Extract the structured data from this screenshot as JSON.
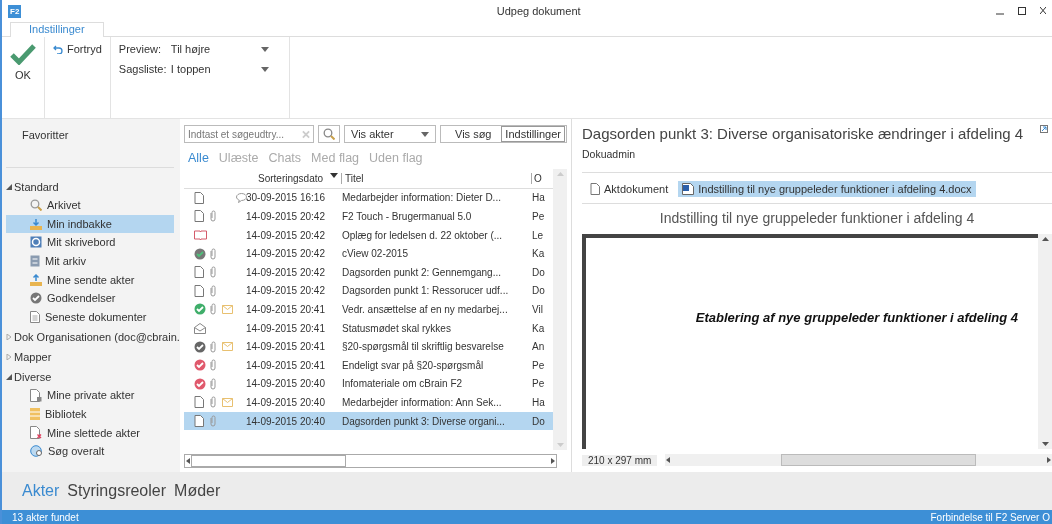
{
  "window": {
    "app_badge": "F2",
    "title": "Udpeg dokument"
  },
  "ribbon": {
    "tabs": [
      {
        "label": "Indstillinger",
        "selected": true
      }
    ],
    "ok": "OK",
    "undo": "Fortryd",
    "settings": [
      {
        "label": "Preview:",
        "value": "Til højre"
      },
      {
        "label": "Sagsliste:",
        "value": "I toppen"
      }
    ]
  },
  "sidebar": {
    "favorites": "Favoritter",
    "groups": [
      {
        "label": "Standard",
        "expanded": true,
        "children": [
          {
            "label": "Arkivet",
            "kind": "search",
            "selected": false
          },
          {
            "label": "Min indbakke",
            "kind": "inbox",
            "selected": true
          },
          {
            "label": "Mit skrivebord",
            "kind": "desk",
            "selected": false
          },
          {
            "label": "Mit arkiv",
            "kind": "cabinet",
            "selected": false
          },
          {
            "label": "Mine sendte akter",
            "kind": "outbox",
            "selected": false
          },
          {
            "label": "Godkendelser",
            "kind": "approval",
            "selected": false
          },
          {
            "label": "Seneste dokumenter",
            "kind": "document",
            "selected": false
          }
        ]
      },
      {
        "label": "Dok Organisationen (doc@cbrain.",
        "expanded": false
      },
      {
        "label": "Mapper",
        "expanded": false
      },
      {
        "label": "Diverse",
        "expanded": true,
        "children": [
          {
            "label": "Mine private akter",
            "kind": "private",
            "selected": false
          },
          {
            "label": "Bibliotek",
            "kind": "library",
            "selected": false
          },
          {
            "label": "Mine slettede akter",
            "kind": "deleted",
            "selected": false
          },
          {
            "label": "Søg overalt",
            "kind": "globe",
            "selected": false
          }
        ]
      }
    ]
  },
  "list": {
    "search": {
      "placeholder": "Indtast et søgeudtry..."
    },
    "view_select": "Vis akter",
    "search_button": "Vis søg",
    "tooltip": "Indstillinger",
    "filters": [
      {
        "label": "Alle",
        "selected": true
      },
      {
        "label": "Ulæste",
        "selected": false
      },
      {
        "label": "Chats",
        "selected": false
      },
      {
        "label": "Med flag",
        "selected": false
      },
      {
        "label": "Uden flag",
        "selected": false
      }
    ],
    "columns": [
      "Sorteringsdato",
      "Titel",
      "O"
    ],
    "rows": [
      {
        "kind": "doc",
        "attachment": false,
        "comment": true,
        "folder": false,
        "date": "30-09-2015 16:16",
        "title": "Medarbejder information: Dieter D...",
        "column_3": "Ha",
        "selected": false
      },
      {
        "kind": "doc",
        "attachment": true,
        "comment": false,
        "folder": false,
        "date": "14-09-2015 20:42",
        "title": "F2 Touch - Brugermanual 5.0",
        "column_3": "Pe",
        "selected": false
      },
      {
        "kind": "book",
        "attachment": false,
        "comment": false,
        "folder": false,
        "date": "14-09-2015 20:42",
        "title": "Oplæg for ledelsen d. 22 oktober (...",
        "column_3": "Le",
        "selected": false
      },
      {
        "kind": "partial",
        "attachment": true,
        "comment": false,
        "folder": false,
        "date": "14-09-2015 20:42",
        "title": "cView 02-2015",
        "column_3": "Ka",
        "selected": false
      },
      {
        "kind": "doc",
        "attachment": true,
        "comment": false,
        "folder": false,
        "date": "14-09-2015 20:42",
        "title": "Dagsorden punkt 2: Gennemgang...",
        "column_3": "Do",
        "selected": false
      },
      {
        "kind": "doc",
        "attachment": true,
        "comment": false,
        "folder": false,
        "date": "14-09-2015 20:42",
        "title": "Dagsorden punkt 1: Ressorucer udf...",
        "column_3": "Do",
        "selected": false
      },
      {
        "kind": "check",
        "color": "#3fae6a",
        "attachment": true,
        "comment": false,
        "folder": true,
        "date": "14-09-2015 20:41",
        "title": "Vedr. ansættelse af en ny medarbej...",
        "column_3": "Vil",
        "selected": false
      },
      {
        "kind": "envelope",
        "attachment": false,
        "comment": false,
        "folder": false,
        "date": "14-09-2015 20:41",
        "title": "Statusmødet skal rykkes",
        "column_3": "Ka",
        "selected": false
      },
      {
        "kind": "check",
        "color": "#666666",
        "attachment": true,
        "comment": false,
        "folder": true,
        "date": "14-09-2015 20:41",
        "title": "§20-spørgsmål til skriftlig besvarelse",
        "column_3": "An",
        "selected": false
      },
      {
        "kind": "check",
        "color": "#e0596c",
        "attachment": true,
        "comment": false,
        "folder": false,
        "date": "14-09-2015 20:41",
        "title": "Endeligt svar på §20-spørgsmål",
        "column_3": "Pe",
        "selected": false
      },
      {
        "kind": "check",
        "color": "#e0596c",
        "attachment": true,
        "comment": false,
        "folder": false,
        "date": "14-09-2015 20:40",
        "title": "Infomateriale om cBrain F2",
        "column_3": "Pe",
        "selected": false
      },
      {
        "kind": "doc",
        "attachment": true,
        "comment": false,
        "folder": true,
        "date": "14-09-2015 20:40",
        "title": "Medarbejder information: Ann Sek...",
        "column_3": "Ha",
        "selected": false
      },
      {
        "kind": "doc",
        "attachment": true,
        "comment": false,
        "folder": false,
        "date": "14-09-2015 20:40",
        "title": "Dagsorden punkt 3: Diverse organi...",
        "column_3": "Do",
        "selected": true
      }
    ]
  },
  "preview": {
    "title": "Dagsorden punkt 3: Diverse organisatoriske ændringer i afdeling 4",
    "author": "Dokuadmin",
    "tabs": [
      {
        "label": "Aktdokument",
        "kind": "doc",
        "selected": false
      },
      {
        "label": "Indstilling til nye gruppeleder funktioner i afdeling 4.docx",
        "kind": "word",
        "selected": true
      }
    ],
    "document_title": "Indstilling til nye gruppeleder funktioner i afdeling 4",
    "page_text": "Etablering af nye gruppeleder funktioner i afdeling 4",
    "page_size": "210 x 297 mm"
  },
  "bottom_tabs": [
    {
      "label": "Akter",
      "selected": true
    },
    {
      "label": "Styringsreoler",
      "selected": false
    },
    {
      "label": "Møder",
      "selected": false
    }
  ],
  "status_bar": {
    "left": "13 akter fundet",
    "right": "Forbindelse til F2 Server O"
  }
}
